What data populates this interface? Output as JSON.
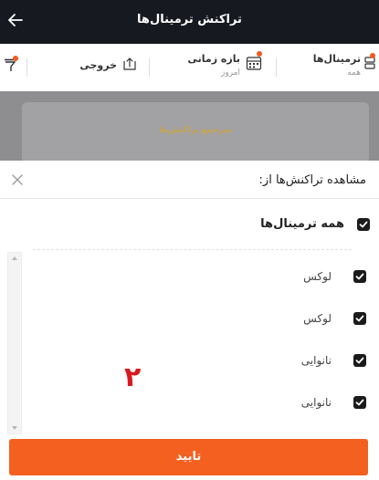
{
  "header": {
    "title": "تراکنش ترمینال‌ها"
  },
  "filter_bar": {
    "terminals": {
      "title": "ترمینال‌ها",
      "sub": "همه"
    },
    "period": {
      "title": "بازه زمانی",
      "sub": "امروز"
    },
    "export": {
      "title": "خروجی"
    }
  },
  "background": {
    "card_title": "سرجمع تراکنش‌ها"
  },
  "sheet": {
    "title": "مشاهده تراکنش‌ها از:",
    "all_label": "همه ترمینال‌ها",
    "items": [
      {
        "label": "لوکس",
        "checked": true
      },
      {
        "label": "لوکس",
        "checked": true
      },
      {
        "label": "نانوایی",
        "checked": true
      },
      {
        "label": "نانوایی",
        "checked": true
      }
    ],
    "annotation": "۲",
    "confirm_label": "تایید"
  },
  "colors": {
    "accent": "#f4601f",
    "header_bg": "#171920",
    "annotation": "#d9191e"
  }
}
